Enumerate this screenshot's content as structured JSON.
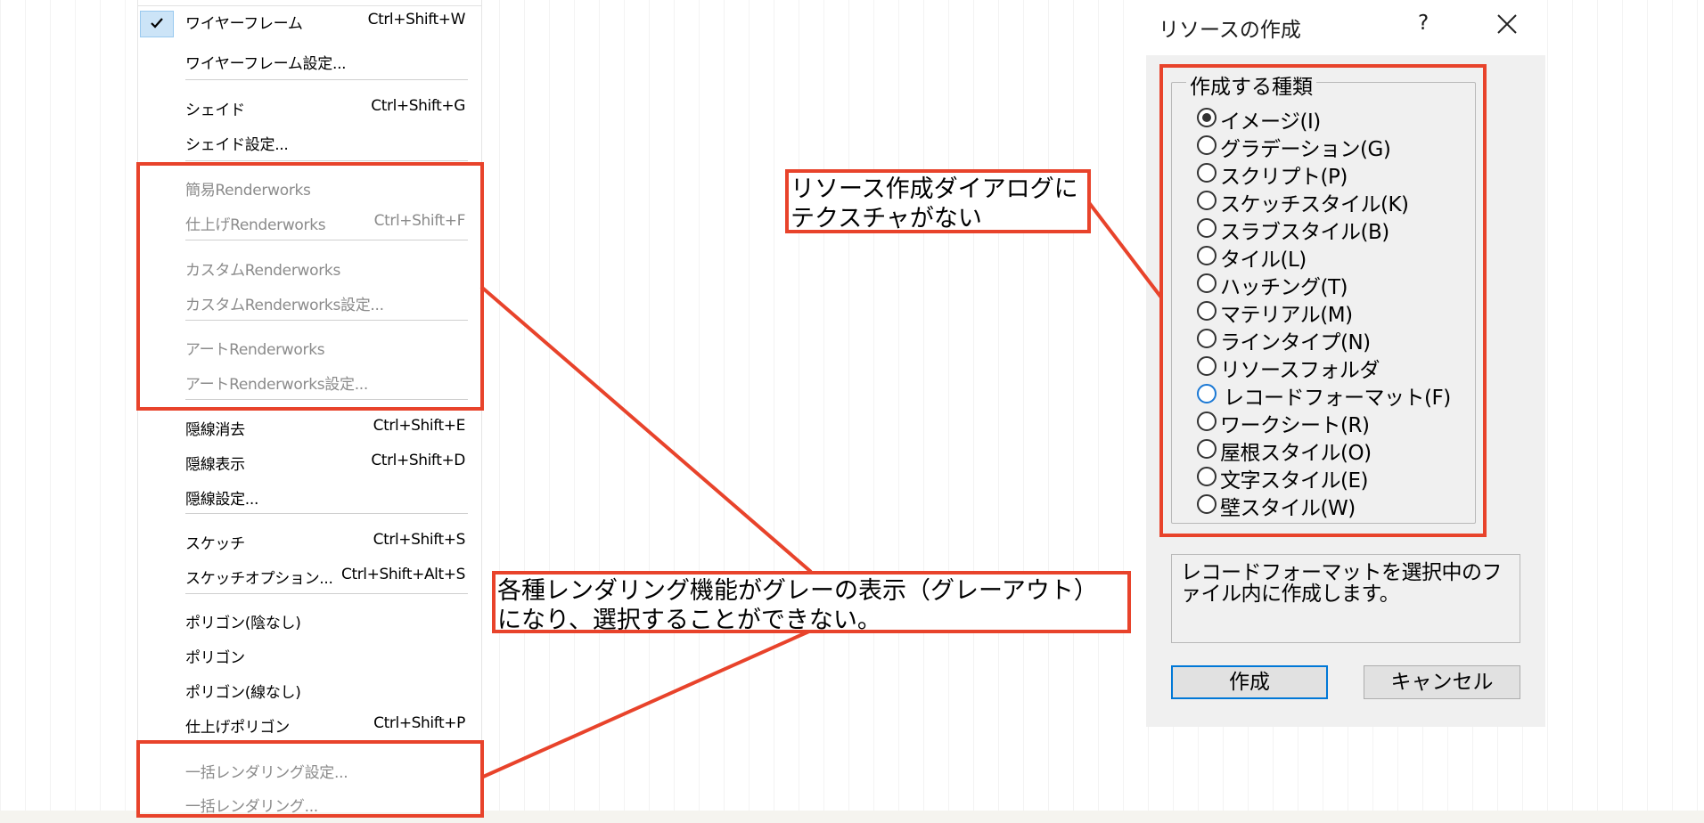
{
  "menu": {
    "items": [
      {
        "label": "ワイヤーフレーム",
        "shortcut": "Ctrl+Shift+W",
        "checked": true,
        "disabled": false
      },
      {
        "label": "ワイヤーフレーム設定...",
        "shortcut": "",
        "disabled": false
      },
      {
        "label": "シェイド",
        "shortcut": "Ctrl+Shift+G",
        "disabled": false
      },
      {
        "label": "シェイド設定...",
        "shortcut": "",
        "disabled": false
      },
      {
        "label": "簡易Renderworks",
        "shortcut": "",
        "disabled": true
      },
      {
        "label": "仕上げRenderworks",
        "shortcut": "Ctrl+Shift+F",
        "disabled": true
      },
      {
        "label": "カスタムRenderworks",
        "shortcut": "",
        "disabled": true
      },
      {
        "label": "カスタムRenderworks設定...",
        "shortcut": "",
        "disabled": true
      },
      {
        "label": "アートRenderworks",
        "shortcut": "",
        "disabled": true
      },
      {
        "label": "アートRenderworks設定...",
        "shortcut": "",
        "disabled": true
      },
      {
        "label": "隠線消去",
        "shortcut": "Ctrl+Shift+E",
        "disabled": false
      },
      {
        "label": "隠線表示",
        "shortcut": "Ctrl+Shift+D",
        "disabled": false
      },
      {
        "label": "隠線設定...",
        "shortcut": "",
        "disabled": false
      },
      {
        "label": "スケッチ",
        "shortcut": "Ctrl+Shift+S",
        "disabled": false
      },
      {
        "label": "スケッチオプション...",
        "shortcut": "Ctrl+Shift+Alt+S",
        "disabled": false
      },
      {
        "label": "ポリゴン(陰なし)",
        "shortcut": "",
        "disabled": false
      },
      {
        "label": "ポリゴン",
        "shortcut": "",
        "disabled": false
      },
      {
        "label": "ポリゴン(線なし)",
        "shortcut": "",
        "disabled": false
      },
      {
        "label": "仕上げポリゴン",
        "shortcut": "Ctrl+Shift+P",
        "disabled": false
      },
      {
        "label": "一括レンダリング設定...",
        "shortcut": "",
        "disabled": true
      },
      {
        "label": "一括レンダリング...",
        "shortcut": "",
        "disabled": true
      }
    ]
  },
  "annotations": {
    "dialog_note": "リソース作成ダイアログに\nテクスチャがない",
    "menu_note": "各種レンダリング機能がグレーの表示（グレーアウト）\nになり、選択することができない。",
    "accent_color": "#e8432b"
  },
  "dialog": {
    "title": "リソースの作成",
    "help_label": "?",
    "close_icon": "close-icon",
    "group_label": "作成する種類",
    "options": [
      {
        "label": "イメージ(I)",
        "selected": true
      },
      {
        "label": "グラデーション(G)",
        "selected": false
      },
      {
        "label": "スクリプト(P)",
        "selected": false
      },
      {
        "label": "スケッチスタイル(K)",
        "selected": false
      },
      {
        "label": "スラブスタイル(B)",
        "selected": false
      },
      {
        "label": "タイル(L)",
        "selected": false
      },
      {
        "label": "ハッチング(T)",
        "selected": false
      },
      {
        "label": "マテリアル(M)",
        "selected": false
      },
      {
        "label": "ラインタイプ(N)",
        "selected": false
      },
      {
        "label": "リソースフォルダ",
        "selected": false
      },
      {
        "label": "レコードフォーマット(F)",
        "selected": false,
        "hover": true
      },
      {
        "label": "ワークシート(R)",
        "selected": false
      },
      {
        "label": "屋根スタイル(O)",
        "selected": false
      },
      {
        "label": "文字スタイル(E)",
        "selected": false
      },
      {
        "label": "壁スタイル(W)",
        "selected": false
      }
    ],
    "description": "レコードフォーマットを選択中のファイル内に作成します。",
    "create_label": "作成",
    "cancel_label": "キャンセル"
  }
}
